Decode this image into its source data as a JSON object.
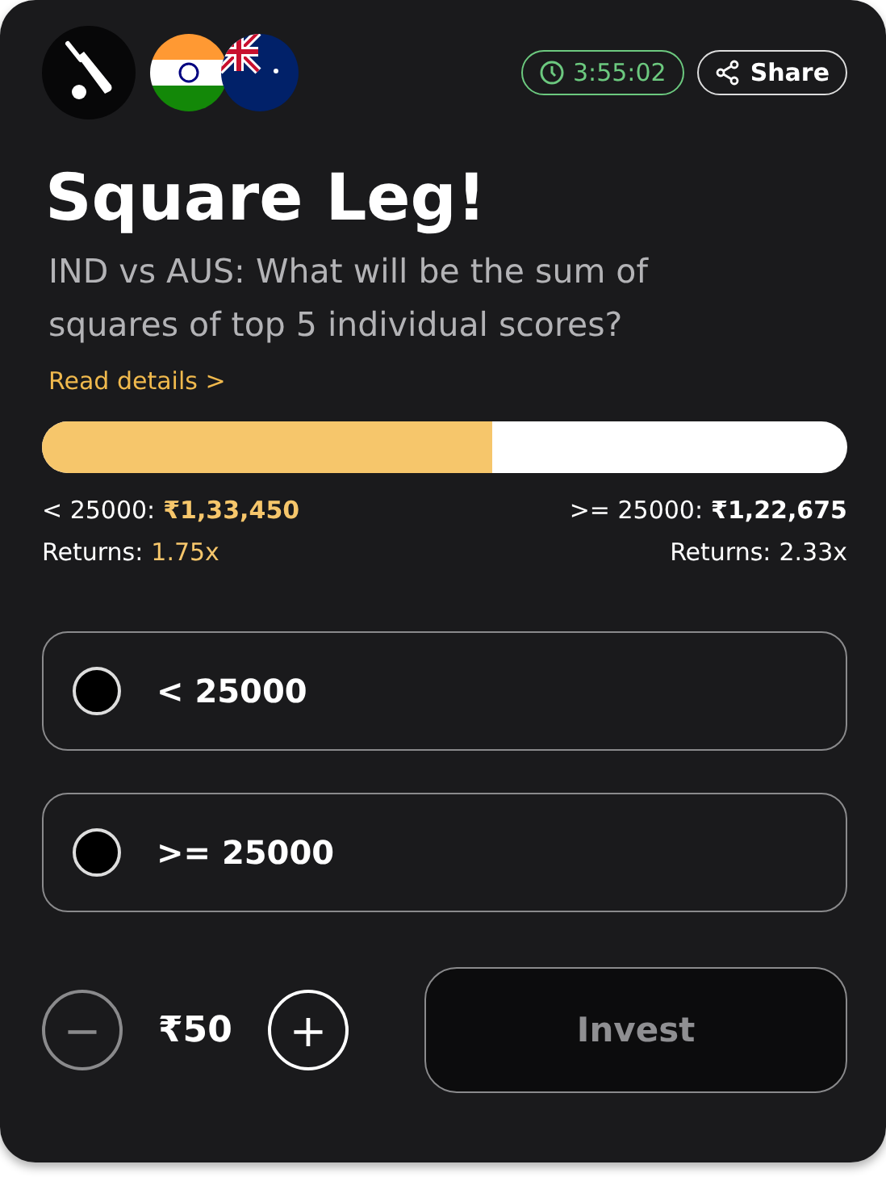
{
  "header": {
    "timer": "3:55:02",
    "share": "Share"
  },
  "title": "Square Leg!",
  "question": "IND vs AUS: What will be the sum of squares of top 5 individual scores?",
  "read_details": "Read details >",
  "pool": {
    "level": 0.56
  },
  "sides": [
    {
      "label": "< 25000:",
      "amount": "₹1,33,450",
      "returns_label": "Returns:",
      "returns": "1.75x",
      "highlight": true
    },
    {
      "label": ">= 25000:",
      "amount": "₹1,22,675",
      "returns_label": "Returns:",
      "returns": "2.33x",
      "highlight": false
    }
  ],
  "options": [
    {
      "label": "< 25000",
      "selected": false
    },
    {
      "label": ">= 25000",
      "selected": false
    }
  ],
  "stake": {
    "minus": {
      "label": "−",
      "disabled": true
    },
    "amount": "₹50",
    "plus": {
      "label": "+",
      "disabled": false
    }
  },
  "invest": {
    "label": "Invest",
    "disabled": true
  }
}
